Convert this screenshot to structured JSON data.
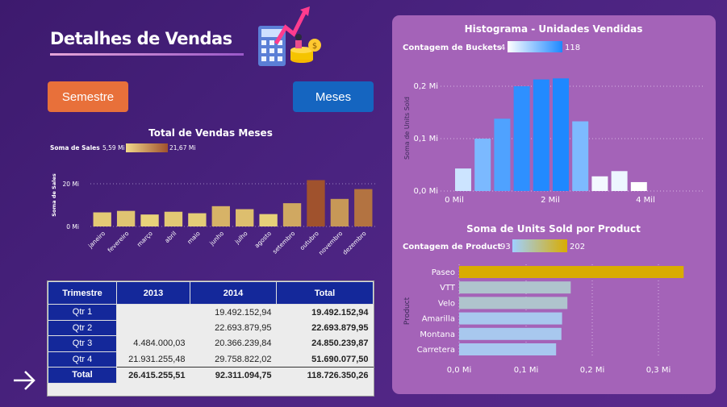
{
  "header": {
    "title": "Detalhes de Vendas"
  },
  "buttons": {
    "semestre": "Semestre",
    "meses": "Meses"
  },
  "colors": {
    "accent_orange": "#e8703a",
    "accent_blue": "#1565c0",
    "panel": "#a463b8",
    "table_header": "#14289a"
  },
  "sales_chart": {
    "title": "Total de Vendas Meses",
    "legend_label": "Soma de  Sales",
    "legend_min": "5,59 Mi",
    "legend_max": "21,67 Mi"
  },
  "hist_chart": {
    "title": "Histograma - Unidades Vendidas",
    "legend_label": "Contagem de Buckets",
    "legend_min": "4",
    "legend_max": "118"
  },
  "prod_chart": {
    "title": "Soma de Units Sold por Product",
    "legend_label": "Contagem de Product",
    "legend_min": "93",
    "legend_max": "202"
  },
  "matrix": {
    "headers": [
      "Trimestre",
      "2013",
      "2014",
      "Total"
    ],
    "rows": [
      [
        "Qtr 1",
        "",
        "19.492.152,94",
        "19.492.152,94"
      ],
      [
        "Qtr 2",
        "",
        "22.693.879,95",
        "22.693.879,95"
      ],
      [
        "Qtr 3",
        "4.484.000,03",
        "20.366.239,84",
        "24.850.239,87"
      ],
      [
        "Qtr 4",
        "21.931.255,48",
        "29.758.822,02",
        "51.690.077,50"
      ]
    ],
    "total": [
      "Total",
      "26.415.255,51",
      "92.311.094,75",
      "118.726.350,26"
    ]
  },
  "chart_data": [
    {
      "type": "bar",
      "title": "Total de Vendas Meses",
      "xlabel": "",
      "ylabel": "Soma de Sales",
      "categories": [
        "janeiro",
        "fevereiro",
        "março",
        "abril",
        "maio",
        "junho",
        "julho",
        "agosto",
        "setembro",
        "outubro",
        "novembro",
        "dezembro"
      ],
      "values": [
        6.6,
        7.3,
        5.6,
        6.9,
        6.2,
        9.5,
        8.1,
        5.8,
        10.9,
        21.7,
        12.9,
        17.5
      ],
      "value_unit": "Mi",
      "yticks": [
        "0 Mi",
        "20 Mi"
      ],
      "ylim": [
        0,
        25
      ],
      "legend": {
        "label": "Soma de  Sales",
        "min": "5,59 Mi",
        "max": "21,67 Mi"
      }
    },
    {
      "type": "bar",
      "title": "Histograma - Unidades Vendidas",
      "xlabel": "",
      "ylabel": "Soma de Units Sold",
      "x": [
        0.2,
        0.6,
        1.0,
        1.4,
        1.8,
        2.2,
        2.6,
        3.0,
        3.4,
        3.8
      ],
      "x_unit": "Mi",
      "values": [
        0.043,
        0.1,
        0.138,
        0.2,
        0.213,
        0.215,
        0.133,
        0.028,
        0.038,
        0.017
      ],
      "value_unit": "Mi",
      "counts": [
        30,
        71,
        93,
        110,
        116,
        118,
        70,
        10,
        13,
        4
      ],
      "xticks": [
        "0 Mil",
        "2 Mil",
        "4 Mil"
      ],
      "yticks": [
        "0,0 Mi",
        "0,1 Mi",
        "0,2 Mi"
      ],
      "ylim": [
        0,
        0.25
      ],
      "legend": {
        "label": "Contagem de Buckets",
        "min": "4",
        "max": "118"
      }
    },
    {
      "type": "bar",
      "title": "Soma de Units Sold por Product",
      "xlabel": "",
      "ylabel": "Product",
      "categories": [
        "Paseo",
        "VTT",
        "Velo",
        "Amarilla",
        "Montana",
        "Carretera"
      ],
      "values": [
        0.338,
        0.168,
        0.163,
        0.155,
        0.154,
        0.146
      ],
      "counts": [
        202,
        109,
        109,
        94,
        94,
        93
      ],
      "value_unit": "Mi",
      "xticks": [
        "0,0 Mi",
        "0,1 Mi",
        "0,2 Mi",
        "0,3 Mi"
      ],
      "xlim": [
        0,
        0.38
      ],
      "legend": {
        "label": "Contagem de Product",
        "min": "93",
        "max": "202"
      }
    }
  ]
}
